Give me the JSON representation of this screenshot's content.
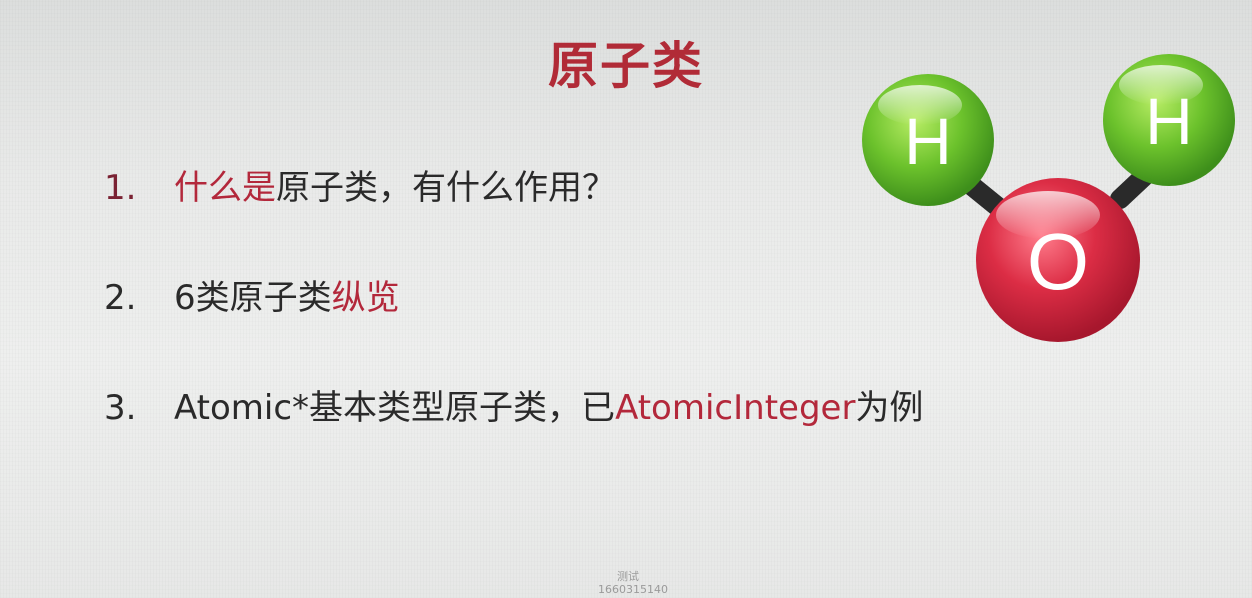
{
  "slide": {
    "title": "原子类",
    "items": [
      {
        "number": "1.",
        "segments": [
          {
            "text": "什么是",
            "highlight": true
          },
          {
            "text": "原子类，有什么作用？",
            "highlight": false
          }
        ]
      },
      {
        "number": "2.",
        "segments": [
          {
            "text": "6类原子类",
            "highlight": false
          },
          {
            "text": "纵览",
            "highlight": true
          }
        ]
      },
      {
        "number": "3.",
        "segments": [
          {
            "text": "Atomic*基本类型原子类，已",
            "highlight": false
          },
          {
            "text": "AtomicInteger",
            "highlight": true
          },
          {
            "text": "为例",
            "highlight": false
          }
        ]
      }
    ],
    "illustration": {
      "name": "water-molecule",
      "atoms": [
        {
          "label": "H",
          "color": "#5dbb2a"
        },
        {
          "label": "H",
          "color": "#5dbb2a"
        },
        {
          "label": "O",
          "color": "#d7293f"
        }
      ]
    },
    "watermark": {
      "line1": "测试",
      "line2": "1660315140"
    }
  },
  "colors": {
    "title": "#b12b37",
    "highlight": "#b3283b",
    "text": "#2a2a2a"
  }
}
